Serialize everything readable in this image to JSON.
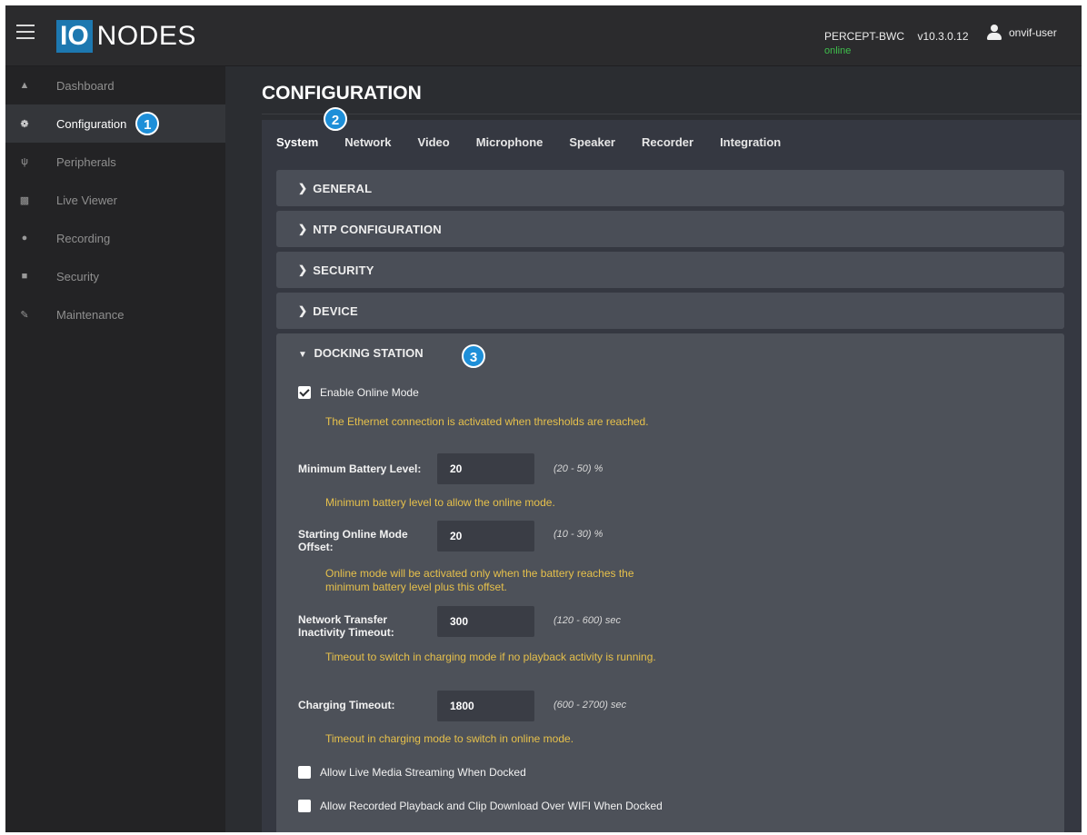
{
  "header": {
    "logo_mark": "IO",
    "logo_text": "NODES",
    "device_name": "PERCEPT-BWC",
    "version": "v10.3.0.12",
    "status": "online",
    "user": "onvif-user"
  },
  "sidebar": {
    "items": [
      {
        "label": "Dashboard",
        "icon": "home-icon"
      },
      {
        "label": "Configuration",
        "icon": "gear-icon"
      },
      {
        "label": "Peripherals",
        "icon": "usb-icon"
      },
      {
        "label": "Live Viewer",
        "icon": "camera-icon"
      },
      {
        "label": "Recording",
        "icon": "record-icon"
      },
      {
        "label": "Security",
        "icon": "lock-icon"
      },
      {
        "label": "Maintenance",
        "icon": "wrench-icon"
      }
    ],
    "active_index": 1
  },
  "badges": [
    "1",
    "2",
    "3"
  ],
  "page_title": "CONFIGURATION",
  "tabs": [
    "System",
    "Network",
    "Video",
    "Microphone",
    "Speaker",
    "Recorder",
    "Integration"
  ],
  "sections": [
    "GENERAL",
    "NTP CONFIGURATION",
    "SECURITY",
    "DEVICE"
  ],
  "docking": {
    "title": "DOCKING STATION",
    "enable_online_mode": {
      "label": "Enable Online Mode",
      "checked": true
    },
    "enable_help": "The Ethernet connection is activated when thresholds are reached.",
    "min_battery": {
      "label": "Minimum Battery Level:",
      "value": "20",
      "range": "(20 - 50) %",
      "help": "Minimum battery level to allow the online mode."
    },
    "start_offset": {
      "label": "Starting Online Mode Offset:",
      "value": "20",
      "range": "(10 - 30) %",
      "help": "Online mode will be activated only when the battery reaches the minimum battery level plus this offset."
    },
    "net_timeout": {
      "label": "Network Transfer Inactivity Timeout:",
      "value": "300",
      "range": "(120 - 600) sec",
      "help": "Timeout to switch in charging mode if no playback activity is running."
    },
    "charging_timeout": {
      "label": "Charging Timeout:",
      "value": "1800",
      "range": "(600 - 2700) sec",
      "help": "Timeout in charging mode to switch in online mode."
    },
    "live_streaming": {
      "label": "Allow Live Media Streaming When Docked",
      "checked": false
    },
    "recorded_playback": {
      "label": "Allow Recorded Playback and Clip Download Over WIFI When Docked",
      "checked": false
    }
  },
  "colors": {
    "accent": "#1e8fd8",
    "help_text": "#e6c04b",
    "online": "#3fbf4c"
  }
}
